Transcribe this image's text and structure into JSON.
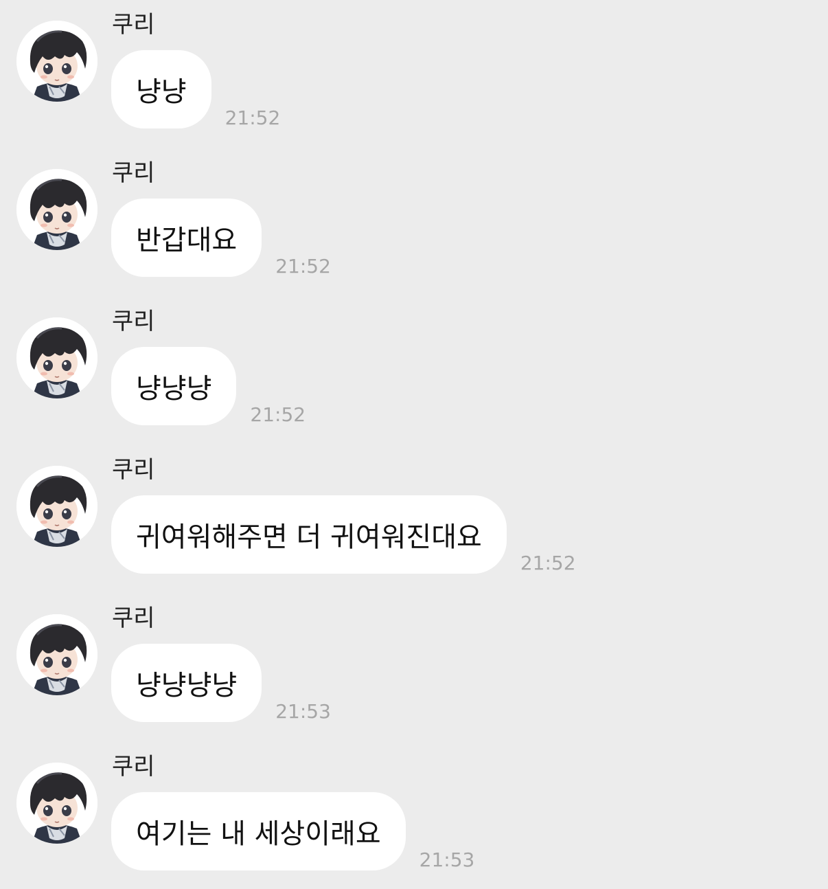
{
  "messages": [
    {
      "sender": "쿠리",
      "text": "냥냥",
      "time": "21:52"
    },
    {
      "sender": "쿠리",
      "text": "반갑대요",
      "time": "21:52"
    },
    {
      "sender": "쿠리",
      "text": "냥냥냥",
      "time": "21:52"
    },
    {
      "sender": "쿠리",
      "text": "귀여워해주면 더 귀여워진대요",
      "time": "21:52"
    },
    {
      "sender": "쿠리",
      "text": "냥냥냥냥",
      "time": "21:53"
    },
    {
      "sender": "쿠리",
      "text": "여기는 내 세상이래요",
      "time": "21:53"
    }
  ],
  "colors": {
    "background": "#ececec",
    "bubble": "#ffffff",
    "timestamp": "#a6a6a6",
    "sender": "#222222"
  },
  "icons": {
    "avatar": "chibi-character-avatar"
  }
}
